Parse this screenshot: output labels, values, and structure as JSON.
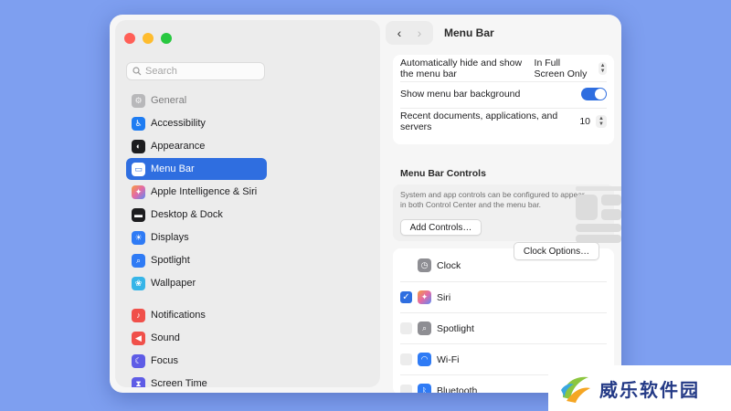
{
  "sidebar": {
    "search_placeholder": "Search",
    "items": [
      {
        "label": "General",
        "icon": "gear-icon",
        "color": "#8e8e93",
        "faded": true
      },
      {
        "label": "Accessibility",
        "icon": "accessibility-icon",
        "color": "#1e7cf2"
      },
      {
        "label": "Appearance",
        "icon": "appearance-icon",
        "color": "#1d1d1f"
      },
      {
        "label": "Menu Bar",
        "icon": "menubar-icon",
        "color": "#2f6ee0",
        "active": true
      },
      {
        "label": "Apple Intelligence & Siri",
        "icon": "siri-icon",
        "color": "#e36aa7"
      },
      {
        "label": "Desktop & Dock",
        "icon": "dock-icon",
        "color": "#1d1d1f"
      },
      {
        "label": "Displays",
        "icon": "displays-icon",
        "color": "#2f7bf5"
      },
      {
        "label": "Spotlight",
        "icon": "spotlight-icon",
        "color": "#2f7bf5"
      },
      {
        "label": "Wallpaper",
        "icon": "wallpaper-icon",
        "color": "#36b5e8"
      },
      {
        "label": "Notifications",
        "icon": "notifications-icon",
        "color": "#f0504a"
      },
      {
        "label": "Sound",
        "icon": "sound-icon",
        "color": "#f0504a"
      },
      {
        "label": "Focus",
        "icon": "focus-icon",
        "color": "#5e5ce6"
      },
      {
        "label": "Screen Time",
        "icon": "screen-time-icon",
        "color": "#5e5ce6"
      }
    ]
  },
  "header": {
    "title": "Menu Bar",
    "back": "‹",
    "forward": "›"
  },
  "settings": {
    "autohide_label": "Automatically hide and show the menu bar",
    "autohide_value": "In Full Screen Only",
    "background_label": "Show menu bar background",
    "background_on": true,
    "recent_label": "Recent documents, applications, and servers",
    "recent_value": "10"
  },
  "controls_section": {
    "title": "Menu Bar Controls",
    "description": "System and app controls can be configured to appear in both Control Center and the menu bar.",
    "add_button": "Add Controls…"
  },
  "controls": [
    {
      "label": "Clock",
      "icon": "clock-icon",
      "color": "#8e8e93",
      "checked": null,
      "options": "Clock Options…"
    },
    {
      "label": "Siri",
      "icon": "siri-icon",
      "color": "#e36aa7",
      "checked": true
    },
    {
      "label": "Spotlight",
      "icon": "spotlight-icon",
      "color": "#8e8e93",
      "checked": false
    },
    {
      "label": "Wi-Fi",
      "icon": "wifi-icon",
      "color": "#2f7bf5",
      "checked": false
    },
    {
      "label": "Bluetooth",
      "icon": "bluetooth-icon",
      "color": "#2f7bf5",
      "checked": false
    }
  ],
  "watermark": {
    "text": "威乐软件园"
  },
  "colors": {
    "accent": "#2f6ee0",
    "desktop": "#7e9ff0"
  }
}
